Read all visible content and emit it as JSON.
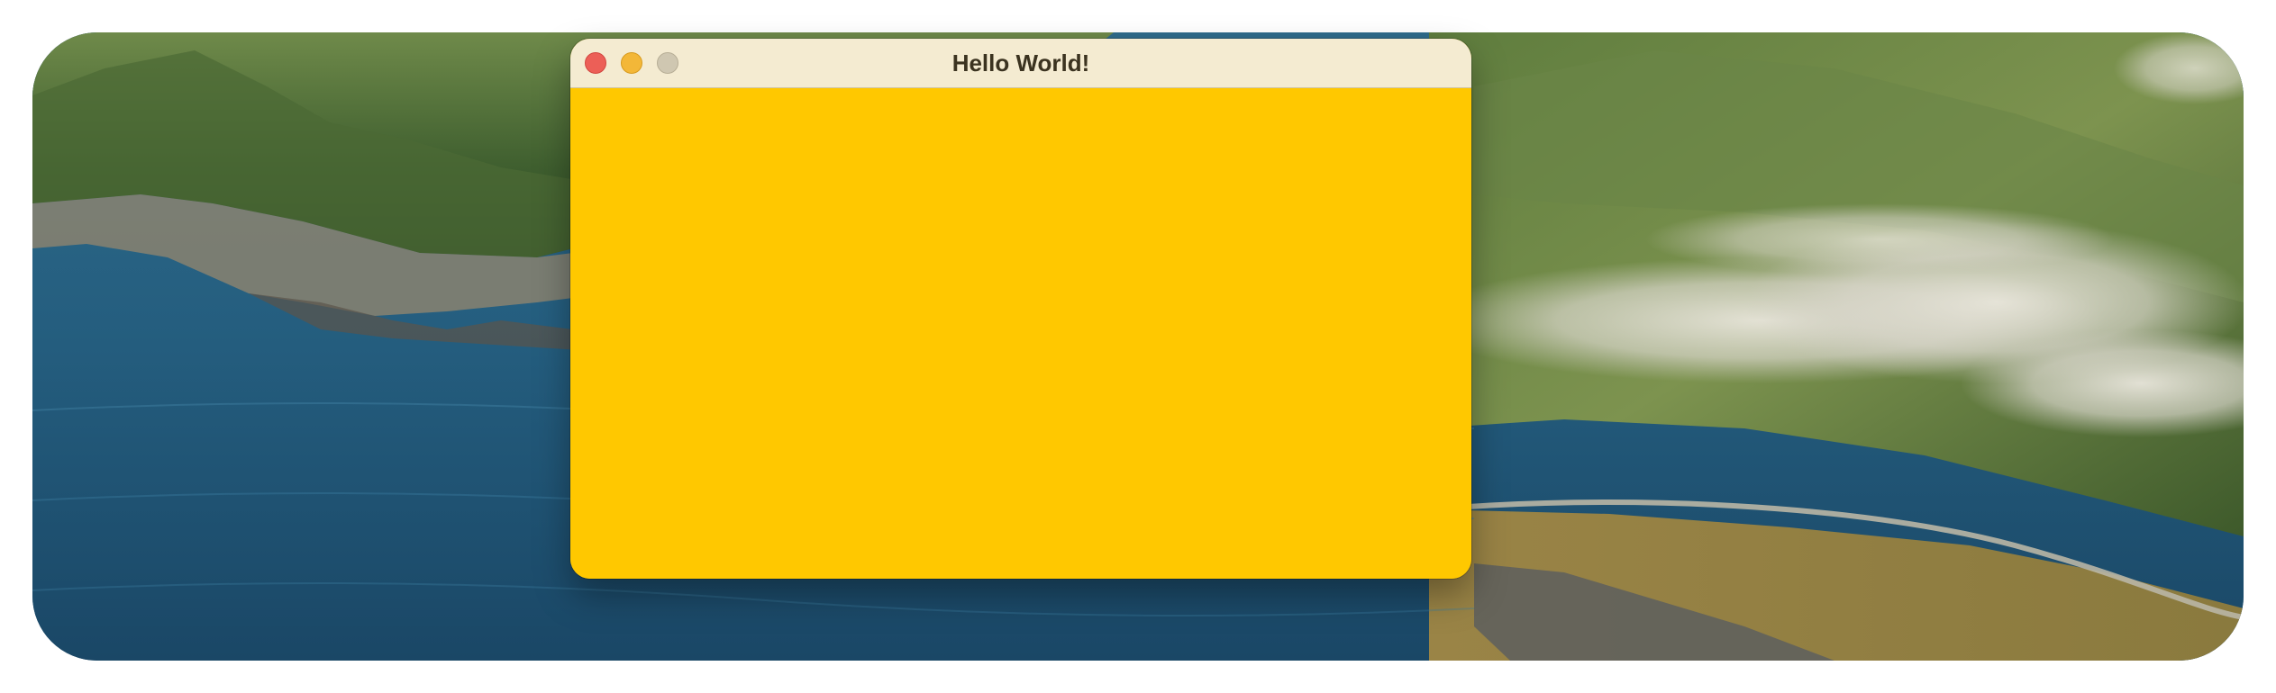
{
  "window": {
    "title": "Hello World!",
    "controls": [
      "close",
      "minimize",
      "zoom"
    ]
  },
  "colors": {
    "titlebar": "#f4ebd1",
    "content": "#ffc800",
    "close": "#ec5f57",
    "minimize": "#f3b738",
    "zoom_disabled": "#cfc7b1"
  }
}
